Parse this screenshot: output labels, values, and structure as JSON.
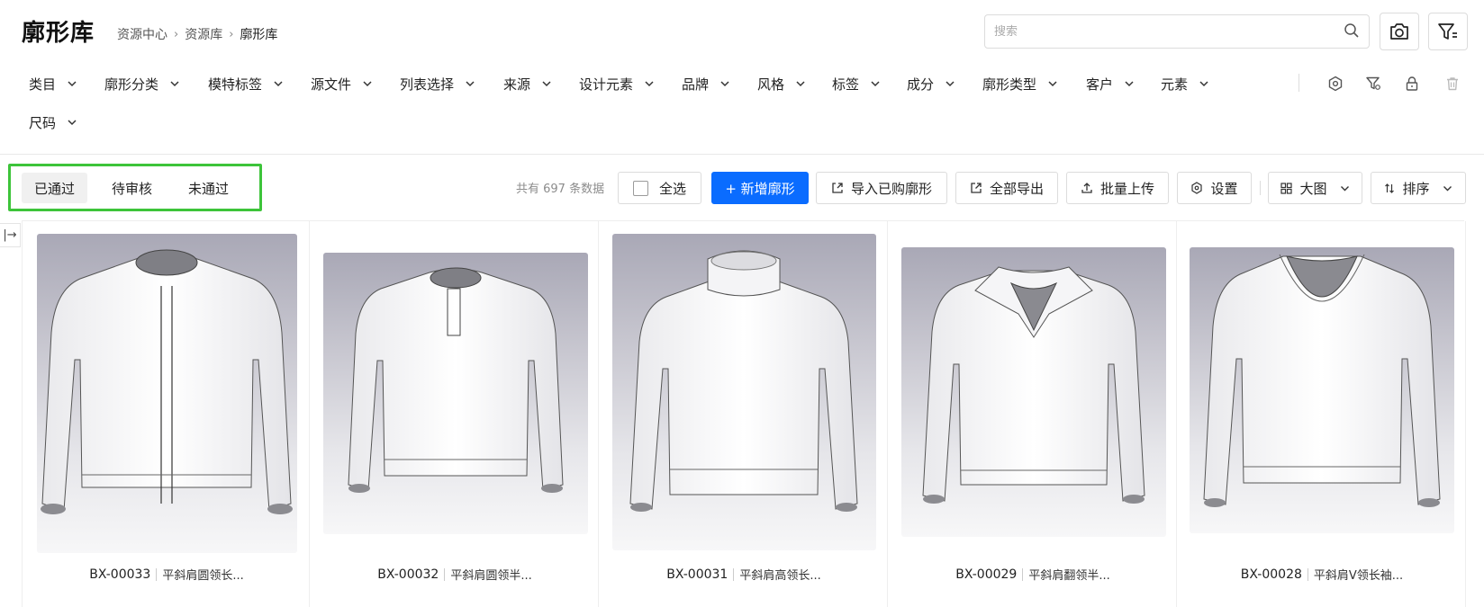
{
  "header": {
    "title": "廓形库",
    "breadcrumb": [
      "资源中心",
      "资源库",
      "廓形库"
    ],
    "search_placeholder": "搜索"
  },
  "filters": [
    {
      "label": "类目"
    },
    {
      "label": "廓形分类"
    },
    {
      "label": "模特标签"
    },
    {
      "label": "源文件"
    },
    {
      "label": "列表选择"
    },
    {
      "label": "来源"
    },
    {
      "label": "设计元素"
    },
    {
      "label": "品牌"
    },
    {
      "label": "风格"
    },
    {
      "label": "标签"
    },
    {
      "label": "成分"
    },
    {
      "label": "廓形类型"
    },
    {
      "label": "客户"
    },
    {
      "label": "元素"
    },
    {
      "label": "尺码"
    }
  ],
  "tabs": [
    {
      "label": "已通过",
      "active": true
    },
    {
      "label": "待审核",
      "active": false
    },
    {
      "label": "未通过",
      "active": false
    }
  ],
  "toolbar": {
    "count_text": "共有 697 条数据",
    "select_all": "全选",
    "add_label": "+ 新增廓形",
    "import_label": "导入已购廓形",
    "export_label": "全部导出",
    "upload_label": "批量上传",
    "settings_label": "设置",
    "view_label": "大图",
    "sort_label": "排序"
  },
  "side_toggle": "|→",
  "cards": [
    {
      "code": "BX-00033",
      "desc": "平斜肩圆领长...",
      "collar": "round-zip"
    },
    {
      "code": "BX-00032",
      "desc": "平斜肩圆领半...",
      "collar": "round-placket"
    },
    {
      "code": "BX-00031",
      "desc": "平斜肩高领长...",
      "collar": "turtle"
    },
    {
      "code": "BX-00029",
      "desc": "平斜肩翻领半...",
      "collar": "polo"
    },
    {
      "code": "BX-00028",
      "desc": "平斜肩V领长袖...",
      "collar": "v"
    }
  ],
  "colors": {
    "primary": "#0a6cff",
    "highlight_border": "#3dc43a",
    "text": "#1f1f1f",
    "muted": "#8c8c8c"
  }
}
